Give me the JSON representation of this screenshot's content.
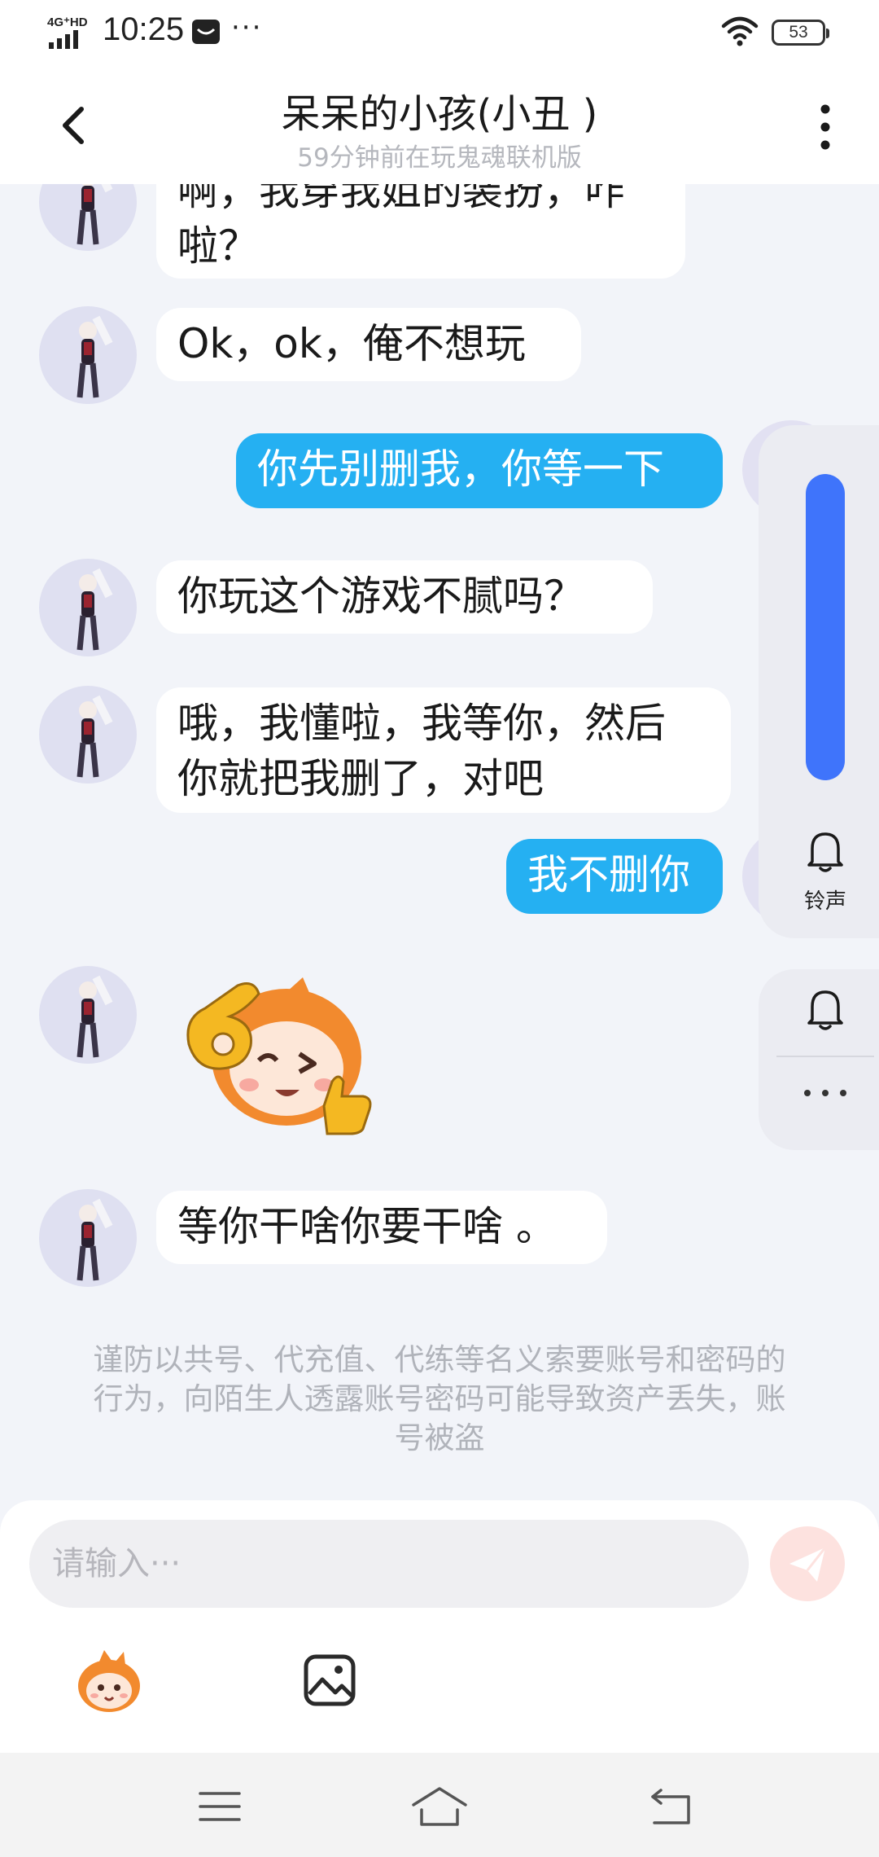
{
  "status_bar": {
    "network": "4G⁺HD",
    "time": "10:25",
    "dots": "···",
    "battery": "53"
  },
  "header": {
    "title": "呆呆的小孩(小丑 )",
    "subtitle": "59分钟前在玩鬼魂联机版",
    "back_icon": "chevron-left-icon",
    "more_icon": "more-vertical-icon"
  },
  "messages": [
    {
      "sender": "other",
      "lines": [
        "啊，我穿我姐的装扮，咋",
        "啦？"
      ]
    },
    {
      "sender": "other",
      "lines": [
        "Ok，ok，俺不想玩"
      ]
    },
    {
      "sender": "me",
      "lines": [
        "你先别删我，你等一下"
      ]
    },
    {
      "sender": "other",
      "lines": [
        "你玩这个游戏不腻吗？"
      ]
    },
    {
      "sender": "other",
      "lines": [
        "哦，我懂啦，我等你，然后",
        "你就把我删了，对吧"
      ]
    },
    {
      "sender": "me",
      "lines": [
        "我不删你"
      ]
    },
    {
      "sender": "other",
      "type": "sticker",
      "sticker_icon": "ok-gesture-sticker-icon"
    },
    {
      "sender": "other",
      "lines": [
        "等你干啥你要干啥 。"
      ]
    }
  ],
  "notice": "谨防以共号、代充值、代练等名义索要账号和密码的行为，向陌生人透露账号密码可能导致资产丢失，账号被盗",
  "side_panel": {
    "ringtone_label": "铃声",
    "bell_icon": "bell-icon",
    "more_icon": "more-horizontal-icon"
  },
  "input": {
    "placeholder": "请输入···",
    "send_icon": "send-icon",
    "emoji_icon": "emoji-mascot-icon",
    "image_icon": "image-icon"
  },
  "nav": {
    "menu_icon": "menu-icon",
    "home_icon": "home-icon",
    "back_icon": "back-icon"
  },
  "colors": {
    "my_bubble": "#25b0f2",
    "slider": "#3f74fb",
    "background": "#f2f4f9"
  }
}
